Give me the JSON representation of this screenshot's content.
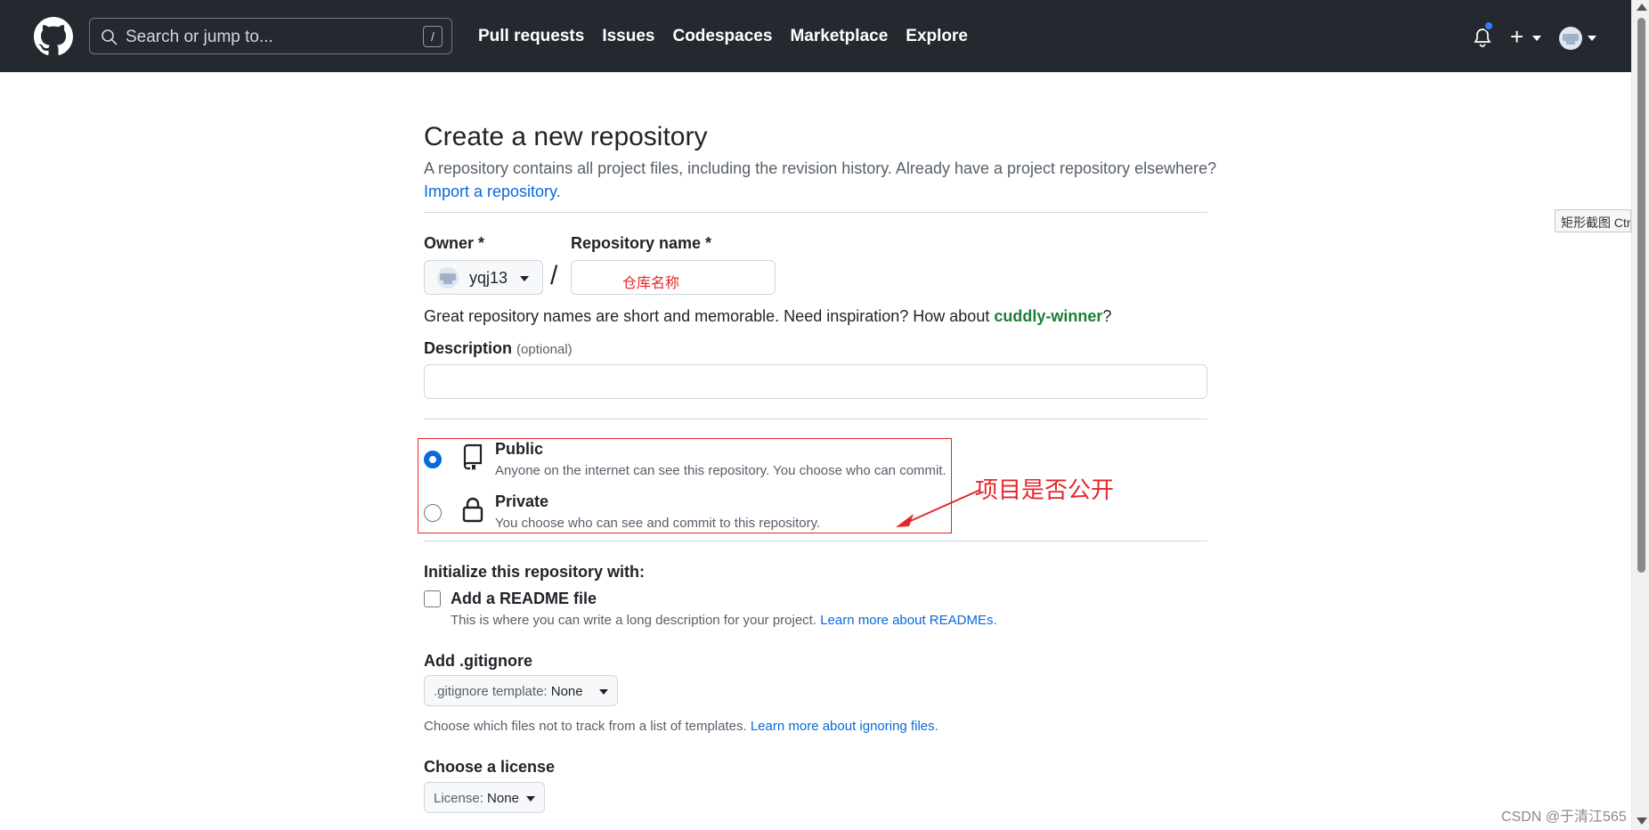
{
  "header": {
    "search_placeholder": "Search or jump to...",
    "search_shortcut": "/",
    "nav": [
      "Pull requests",
      "Issues",
      "Codespaces",
      "Marketplace",
      "Explore"
    ],
    "new_menu_label": "+"
  },
  "page": {
    "title": "Create a new repository",
    "subtitle": "A repository contains all project files, including the revision history. Already have a project repository elsewhere?",
    "import_link": "Import a repository."
  },
  "owner": {
    "label": "Owner *",
    "name": "yqj13"
  },
  "repo_name": {
    "label": "Repository name *",
    "separator": "/",
    "annotation": "仓库名称"
  },
  "hint": {
    "text": "Great repository names are short and memorable. Need inspiration? How about ",
    "suggestion": "cuddly-winner",
    "suffix": "?"
  },
  "description": {
    "label": "Description",
    "optional": "(optional)"
  },
  "visibility": {
    "public_title": "Public",
    "public_desc": "Anyone on the internet can see this repository. You choose who can commit.",
    "private_title": "Private",
    "private_desc": "You choose who can see and commit to this repository.",
    "selected": "Public",
    "annotation": "项目是否公开"
  },
  "init": {
    "heading": "Initialize this repository with:",
    "readme_label": "Add a README file",
    "readme_desc": "This is where you can write a long description for your project.",
    "readme_link": "Learn more about READMEs."
  },
  "gitignore": {
    "heading": "Add .gitignore",
    "select_prefix": ".gitignore template: ",
    "select_value": "None",
    "desc": "Choose which files not to track from a list of templates.",
    "link": "Learn more about ignoring files."
  },
  "license": {
    "heading": "Choose a license",
    "select_prefix": "License: ",
    "select_value": "None"
  },
  "overlay": {
    "tooltip": "矩形截图 Ctrl +",
    "watermark": "CSDN @于清江565"
  },
  "colors": {
    "header_bg": "#24292f",
    "link": "#0969da",
    "suggestion": "#1a7f37",
    "annotation": "#e5262b"
  }
}
